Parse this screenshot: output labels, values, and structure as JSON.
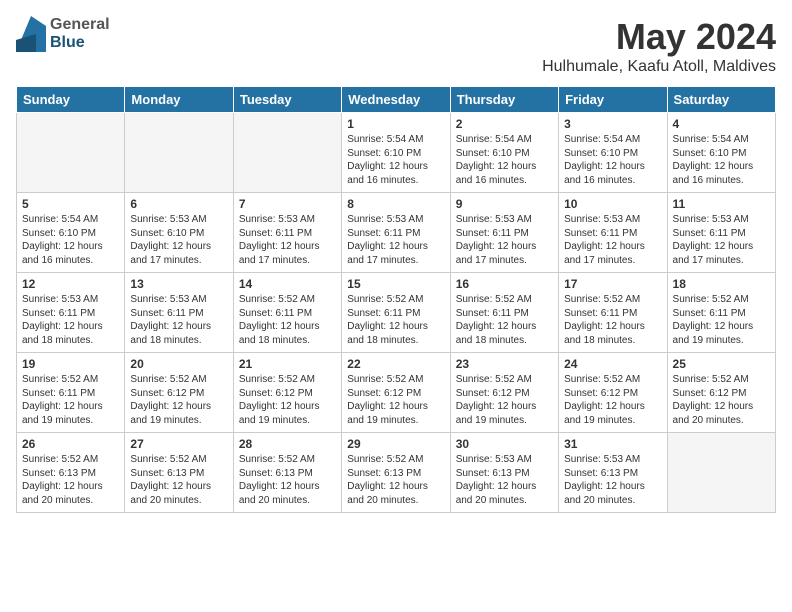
{
  "header": {
    "logo_general": "General",
    "logo_blue": "Blue",
    "month": "May 2024",
    "location": "Hulhumale, Kaafu Atoll, Maldives"
  },
  "days_of_week": [
    "Sunday",
    "Monday",
    "Tuesday",
    "Wednesday",
    "Thursday",
    "Friday",
    "Saturday"
  ],
  "weeks": [
    [
      {
        "day": "",
        "info": ""
      },
      {
        "day": "",
        "info": ""
      },
      {
        "day": "",
        "info": ""
      },
      {
        "day": "1",
        "info": "Sunrise: 5:54 AM\nSunset: 6:10 PM\nDaylight: 12 hours\nand 16 minutes."
      },
      {
        "day": "2",
        "info": "Sunrise: 5:54 AM\nSunset: 6:10 PM\nDaylight: 12 hours\nand 16 minutes."
      },
      {
        "day": "3",
        "info": "Sunrise: 5:54 AM\nSunset: 6:10 PM\nDaylight: 12 hours\nand 16 minutes."
      },
      {
        "day": "4",
        "info": "Sunrise: 5:54 AM\nSunset: 6:10 PM\nDaylight: 12 hours\nand 16 minutes."
      }
    ],
    [
      {
        "day": "5",
        "info": "Sunrise: 5:54 AM\nSunset: 6:10 PM\nDaylight: 12 hours\nand 16 minutes."
      },
      {
        "day": "6",
        "info": "Sunrise: 5:53 AM\nSunset: 6:10 PM\nDaylight: 12 hours\nand 17 minutes."
      },
      {
        "day": "7",
        "info": "Sunrise: 5:53 AM\nSunset: 6:11 PM\nDaylight: 12 hours\nand 17 minutes."
      },
      {
        "day": "8",
        "info": "Sunrise: 5:53 AM\nSunset: 6:11 PM\nDaylight: 12 hours\nand 17 minutes."
      },
      {
        "day": "9",
        "info": "Sunrise: 5:53 AM\nSunset: 6:11 PM\nDaylight: 12 hours\nand 17 minutes."
      },
      {
        "day": "10",
        "info": "Sunrise: 5:53 AM\nSunset: 6:11 PM\nDaylight: 12 hours\nand 17 minutes."
      },
      {
        "day": "11",
        "info": "Sunrise: 5:53 AM\nSunset: 6:11 PM\nDaylight: 12 hours\nand 17 minutes."
      }
    ],
    [
      {
        "day": "12",
        "info": "Sunrise: 5:53 AM\nSunset: 6:11 PM\nDaylight: 12 hours\nand 18 minutes."
      },
      {
        "day": "13",
        "info": "Sunrise: 5:53 AM\nSunset: 6:11 PM\nDaylight: 12 hours\nand 18 minutes."
      },
      {
        "day": "14",
        "info": "Sunrise: 5:52 AM\nSunset: 6:11 PM\nDaylight: 12 hours\nand 18 minutes."
      },
      {
        "day": "15",
        "info": "Sunrise: 5:52 AM\nSunset: 6:11 PM\nDaylight: 12 hours\nand 18 minutes."
      },
      {
        "day": "16",
        "info": "Sunrise: 5:52 AM\nSunset: 6:11 PM\nDaylight: 12 hours\nand 18 minutes."
      },
      {
        "day": "17",
        "info": "Sunrise: 5:52 AM\nSunset: 6:11 PM\nDaylight: 12 hours\nand 18 minutes."
      },
      {
        "day": "18",
        "info": "Sunrise: 5:52 AM\nSunset: 6:11 PM\nDaylight: 12 hours\nand 19 minutes."
      }
    ],
    [
      {
        "day": "19",
        "info": "Sunrise: 5:52 AM\nSunset: 6:11 PM\nDaylight: 12 hours\nand 19 minutes."
      },
      {
        "day": "20",
        "info": "Sunrise: 5:52 AM\nSunset: 6:12 PM\nDaylight: 12 hours\nand 19 minutes."
      },
      {
        "day": "21",
        "info": "Sunrise: 5:52 AM\nSunset: 6:12 PM\nDaylight: 12 hours\nand 19 minutes."
      },
      {
        "day": "22",
        "info": "Sunrise: 5:52 AM\nSunset: 6:12 PM\nDaylight: 12 hours\nand 19 minutes."
      },
      {
        "day": "23",
        "info": "Sunrise: 5:52 AM\nSunset: 6:12 PM\nDaylight: 12 hours\nand 19 minutes."
      },
      {
        "day": "24",
        "info": "Sunrise: 5:52 AM\nSunset: 6:12 PM\nDaylight: 12 hours\nand 19 minutes."
      },
      {
        "day": "25",
        "info": "Sunrise: 5:52 AM\nSunset: 6:12 PM\nDaylight: 12 hours\nand 20 minutes."
      }
    ],
    [
      {
        "day": "26",
        "info": "Sunrise: 5:52 AM\nSunset: 6:13 PM\nDaylight: 12 hours\nand 20 minutes."
      },
      {
        "day": "27",
        "info": "Sunrise: 5:52 AM\nSunset: 6:13 PM\nDaylight: 12 hours\nand 20 minutes."
      },
      {
        "day": "28",
        "info": "Sunrise: 5:52 AM\nSunset: 6:13 PM\nDaylight: 12 hours\nand 20 minutes."
      },
      {
        "day": "29",
        "info": "Sunrise: 5:52 AM\nSunset: 6:13 PM\nDaylight: 12 hours\nand 20 minutes."
      },
      {
        "day": "30",
        "info": "Sunrise: 5:53 AM\nSunset: 6:13 PM\nDaylight: 12 hours\nand 20 minutes."
      },
      {
        "day": "31",
        "info": "Sunrise: 5:53 AM\nSunset: 6:13 PM\nDaylight: 12 hours\nand 20 minutes."
      },
      {
        "day": "",
        "info": ""
      }
    ]
  ]
}
